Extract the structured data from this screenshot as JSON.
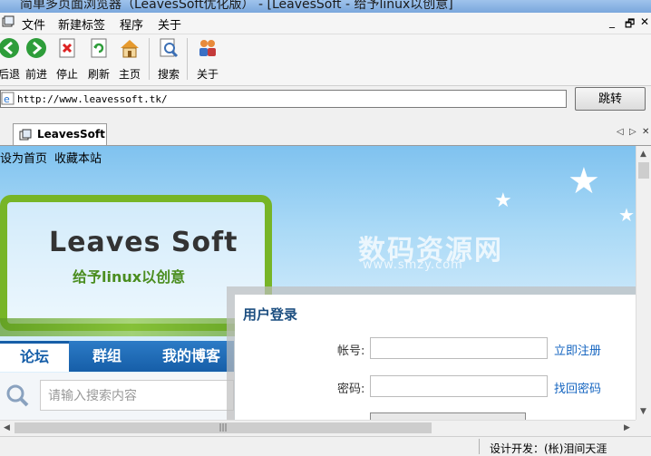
{
  "window": {
    "title": "简单多页面浏览器（LeavesSoft优化版） - [LeavesSoft - 给予linux以创意]"
  },
  "menu": {
    "items": [
      "文件",
      "新建标签",
      "程序",
      "关于"
    ],
    "window_controls": [
      "_",
      "🗗",
      "✕"
    ]
  },
  "toolbar": {
    "buttons": [
      {
        "label": "后退",
        "icon": "back-arrow-icon"
      },
      {
        "label": "前进",
        "icon": "forward-arrow-icon"
      },
      {
        "label": "停止",
        "icon": "stop-icon"
      },
      {
        "label": "刷新",
        "icon": "refresh-icon"
      },
      {
        "label": "主页",
        "icon": "home-icon"
      },
      {
        "label": "搜索",
        "icon": "search-icon"
      },
      {
        "label": "关于",
        "icon": "users-icon"
      }
    ]
  },
  "address": {
    "url": "http://www.leavessoft.tk/",
    "go_label": "跳转"
  },
  "tabs": {
    "active_label": "LeavesSoft",
    "controls": [
      "◁",
      "▷",
      "✕"
    ]
  },
  "page": {
    "top_links": [
      "设为首页",
      "收藏本站"
    ],
    "brand": "Leaves Soft",
    "slogan": "给予linux以创意",
    "watermark": "数码资源网",
    "watermark_sub": "www.smzy.com",
    "nav_tabs": [
      "论坛",
      "群组",
      "我的博客"
    ],
    "search_placeholder": "请输入搜索内容",
    "login": {
      "title": "用户登录",
      "username_label": "帐号:",
      "password_label": "密码:",
      "register_link": "立即注册",
      "forgot_link": "找回密码"
    }
  },
  "status": {
    "text": "设计开发：(枨)泪间天涯"
  },
  "colors": {
    "nav_blue": "#165ea8",
    "leaf_green": "#77b527",
    "link_blue": "#1565c0"
  }
}
